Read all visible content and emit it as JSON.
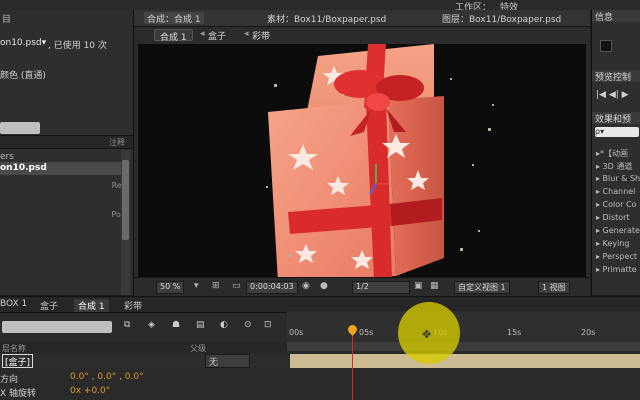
{
  "topbar": {
    "workspace_label": "工作区：",
    "workspace_value": "特效"
  },
  "project_panel": {
    "header_label": "目",
    "file_name": "on10.psd▾",
    "usage_text": ", 已使用 10 次",
    "color_mode": "颜色 (直通)",
    "column_header": "注释",
    "rows": [
      "ers",
      "on10.psd"
    ],
    "side_labels": [
      "Rer",
      "Pos"
    ]
  },
  "viewer": {
    "tabs": [
      "合成：合成 1",
      "素材：Box11/Boxpaper.psd",
      "图层：Box11/Boxpaper.psd"
    ],
    "breadcrumbs": [
      "合成 1",
      "盒子",
      "彩带"
    ],
    "zoom": "50 %",
    "timecode": "0:00:04:03",
    "resolution": "1/2",
    "view_mode": "自定义视图 1",
    "view_count": "1 视图"
  },
  "right_panel": {
    "info_title": "信息",
    "preview_title": "预览控制",
    "effects_title": "效果和预",
    "effects_search_placeholder": "ρ▾",
    "effects": [
      "▸*【动画",
      "▸ 3D 通道",
      "▸ Blur & Sh",
      "▸ Channel",
      "▸ Color Co",
      "▸ Distort",
      "▸ Generate",
      "▸ Keying",
      "▸ Perspect",
      "▸ Primatte"
    ]
  },
  "timeline": {
    "tabs": [
      "BOX 1",
      "盒子",
      "合成 1",
      "彩带"
    ],
    "active_tab": "合成 1",
    "ruler_marks": [
      "00s",
      "05s",
      "10s",
      "15s",
      "20s"
    ],
    "columns": {
      "layer_name": "层名称",
      "parent": "父级"
    },
    "layer_name": "[盒子]",
    "parent_value": "无",
    "properties": [
      {
        "label": "方向",
        "value": "0.0° , 0.0° , 0.0°"
      },
      {
        "label": "X 轴旋转",
        "value": "0x +0.0°"
      }
    ]
  },
  "colors": {
    "accent_orange": "#f2a51d",
    "playhead_red": "#d9262a",
    "layer_bar": "#cdbb93",
    "cursor_highlight": "#d6cc00"
  }
}
